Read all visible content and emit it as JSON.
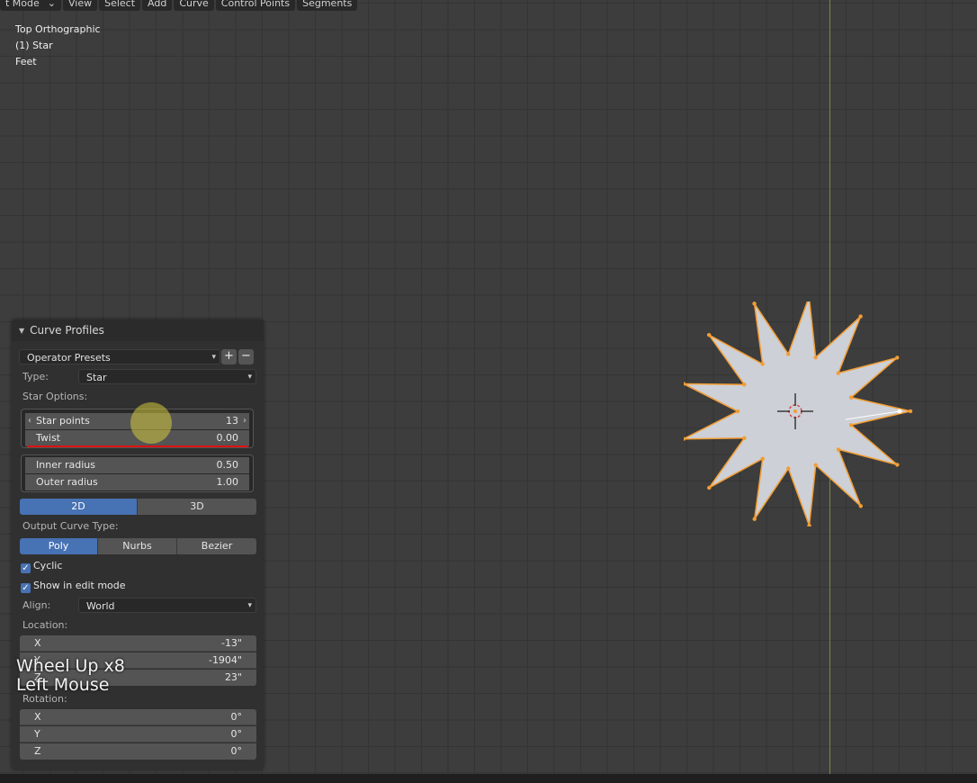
{
  "menubar": {
    "mode": "t Mode",
    "items": [
      "View",
      "Select",
      "Add",
      "Curve",
      "Control Points",
      "Segments"
    ]
  },
  "viewport_info": {
    "view": "Top Orthographic",
    "object": "(1) Star",
    "units": "Feet"
  },
  "panel": {
    "title": "Curve Profiles",
    "presets": "Operator Presets",
    "type_label": "Type:",
    "type_value": "Star",
    "star_options_label": "Star Options:",
    "star_points": {
      "label": "Star points",
      "value": "13"
    },
    "twist": {
      "label": "Twist",
      "value": "0.00"
    },
    "inner_radius": {
      "label": "Inner radius",
      "value": "0.50"
    },
    "outer_radius": {
      "label": "Outer radius",
      "value": "1.00"
    },
    "dim_2d": "2D",
    "dim_3d": "3D",
    "output_type_label": "Output Curve Type:",
    "output_types": [
      "Poly",
      "Nurbs",
      "Bezier"
    ],
    "cyclic": "Cyclic",
    "show_edit": "Show in edit mode",
    "align_label": "Align:",
    "align_value": "World",
    "location_label": "Location:",
    "location": [
      {
        "axis": "X",
        "value": "-13\""
      },
      {
        "axis": "Y",
        "value": "-1904\""
      },
      {
        "axis": "Z",
        "value": "23\""
      }
    ],
    "rotation_label": "Rotation:",
    "rotation": [
      {
        "axis": "X",
        "value": "0°"
      },
      {
        "axis": "Y",
        "value": "0°"
      },
      {
        "axis": "Z",
        "value": "0°"
      }
    ]
  },
  "screencast": {
    "line1": "Wheel Up x8",
    "line2": "Left Mouse"
  },
  "colors": {
    "accent": "#4772b3",
    "selection": "#f29d34",
    "y_axis": "#6f8f3b",
    "star_fill": "#cdd0d6"
  },
  "star": {
    "points": 13,
    "inner_radius": 0.5,
    "outer_radius": 1.0
  }
}
